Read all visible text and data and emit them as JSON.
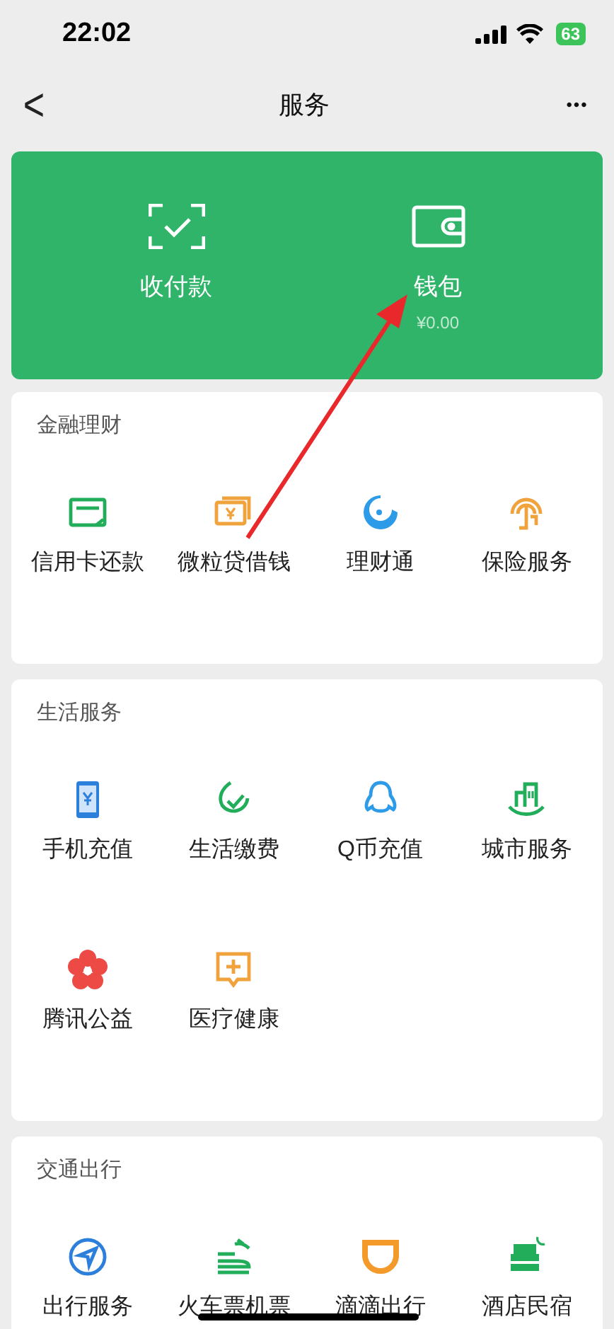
{
  "status_bar": {
    "time": "22:02",
    "battery": "63"
  },
  "nav": {
    "back": "<",
    "title": "服务",
    "more": "•••"
  },
  "wallet_card": {
    "items": [
      {
        "label": "收付款"
      },
      {
        "label": "钱包",
        "sub": "¥0.00"
      }
    ]
  },
  "sections": [
    {
      "title": "金融理财",
      "items": [
        {
          "label": "信用卡还款"
        },
        {
          "label": "微粒贷借钱"
        },
        {
          "label": "理财通"
        },
        {
          "label": "保险服务"
        }
      ]
    },
    {
      "title": "生活服务",
      "items": [
        {
          "label": "手机充值"
        },
        {
          "label": "生活缴费"
        },
        {
          "label": "Q币充值"
        },
        {
          "label": "城市服务"
        },
        {
          "label": "腾讯公益"
        },
        {
          "label": "医疗健康"
        }
      ]
    },
    {
      "title": "交通出行",
      "items": [
        {
          "label": "出行服务"
        },
        {
          "label": "火车票机票"
        },
        {
          "label": "滴滴出行"
        },
        {
          "label": "酒店民宿"
        }
      ]
    }
  ]
}
